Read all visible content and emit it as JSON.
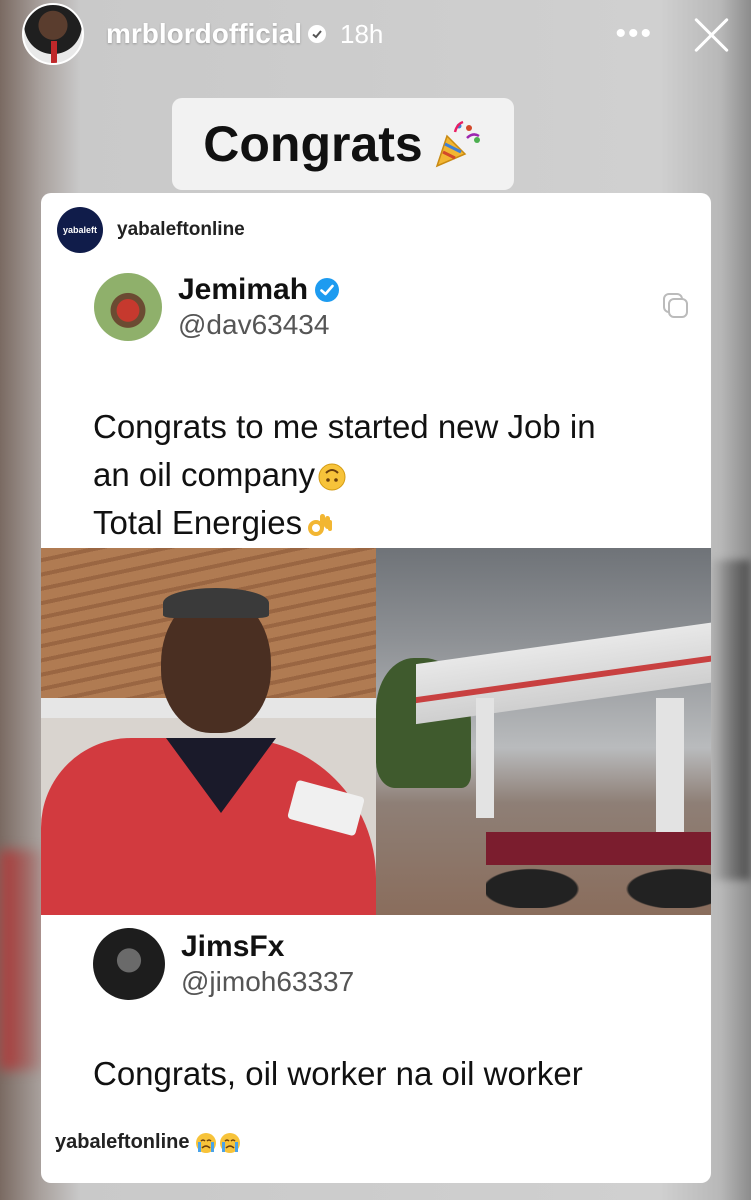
{
  "story": {
    "username": "mrblordofficial",
    "time_ago": "18h",
    "more_label": "•••",
    "sticker_text": "Congrats"
  },
  "card": {
    "source_name": "yabaleftonline",
    "source_logo_text": "yabaleft",
    "tweet": {
      "name": "Jemimah",
      "handle": "@dav63434",
      "line1": "Congrats to me started new Job in",
      "line2": "an oil company",
      "line3": "Total Energies"
    },
    "reply": {
      "name": "JimsFx",
      "handle": "@jimoh63337",
      "text": "Congrats, oil worker na oil worker"
    },
    "caption_name": "yabaleftonline"
  },
  "colors": {
    "verified_blue": "#1d9bf0",
    "total_red": "#d23a3f"
  }
}
